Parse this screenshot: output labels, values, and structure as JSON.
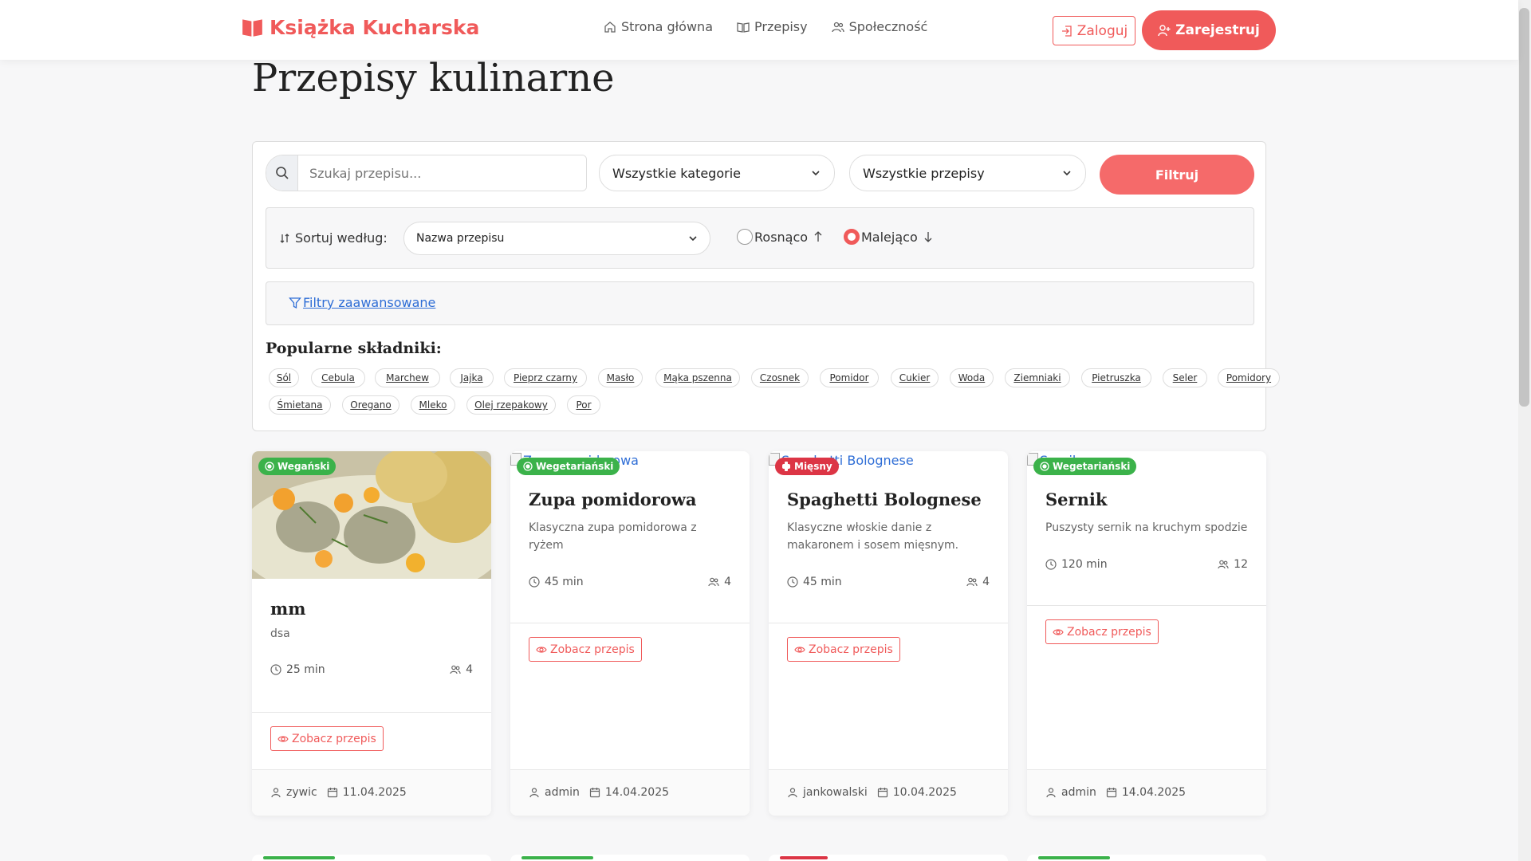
{
  "brand": {
    "name": "Książka Kucharska",
    "color": "#f05a5a"
  },
  "nav": {
    "items": [
      {
        "label": "Strona główna",
        "icon": "home-icon"
      },
      {
        "label": "Przepisy",
        "icon": "book-icon"
      },
      {
        "label": "Społeczność",
        "icon": "users-icon"
      }
    ],
    "login": "Zaloguj",
    "register": "Zarejestruj"
  },
  "page": {
    "title": "Przepisy kulinarne"
  },
  "filters": {
    "search_placeholder": "Szukaj przepisu...",
    "category": "Wszystkie kategorie",
    "recipes": "Wszystkie przepisy",
    "filter_button": "Filtruj",
    "sort_label": "Sortuj według:",
    "sort_value": "Nazwa przepisu",
    "asc_label": "Rosnąco",
    "desc_label": "Malejąco",
    "selected_order": "desc",
    "advanced_label": "Filtry zaawansowane"
  },
  "ingredients": {
    "title": "Popularne składniki:",
    "chips": [
      "Sól",
      "Cebula",
      "Marchew",
      "Jajka",
      "Pieprz czarny",
      "Masło",
      "Mąka pszenna",
      "Czosnek",
      "Pomidor",
      "Cukier",
      "Woda",
      "Ziemniaki",
      "Pietruszka",
      "Seler",
      "Pomidory",
      "Śmietana",
      "Oregano",
      "Mleko",
      "Olej rzepakowy",
      "Por"
    ]
  },
  "cards": [
    {
      "badge": "Wegański",
      "badge_type": "green",
      "title": "mm",
      "desc": "dsa",
      "time": "25 min",
      "servings": "4",
      "view": "Zobacz przepis",
      "author": "zywic",
      "date": "11.04.2025",
      "img_alt": ""
    },
    {
      "badge": "Wegetariański",
      "badge_type": "green",
      "title": "Zupa pomidorowa",
      "desc": "Klasyczna zupa pomidorowa z ryżem",
      "time": "45 min",
      "servings": "4",
      "view": "Zobacz przepis",
      "author": "admin",
      "date": "14.04.2025",
      "img_alt": "Zupa pomidorowa"
    },
    {
      "badge": "Mięsny",
      "badge_type": "red",
      "title": "Spaghetti Bolognese",
      "desc": "Klasyczne włoskie danie z makaronem i sosem mięsnym.",
      "time": "45 min",
      "servings": "4",
      "view": "Zobacz przepis",
      "author": "jankowalski",
      "date": "10.04.2025",
      "img_alt": "Spaghetti Bolognese"
    },
    {
      "badge": "Wegetariański",
      "badge_type": "green",
      "title": "Sernik",
      "desc": "Puszysty sernik na kruchym spodzie",
      "time": "120 min",
      "servings": "12",
      "view": "Zobacz przepis",
      "author": "admin",
      "date": "14.04.2025",
      "img_alt": "Sernik"
    }
  ],
  "colors": {
    "accent": "#f05a5a",
    "green": "#3bb24a",
    "red": "#dc3545",
    "link": "#2f6ed6"
  }
}
